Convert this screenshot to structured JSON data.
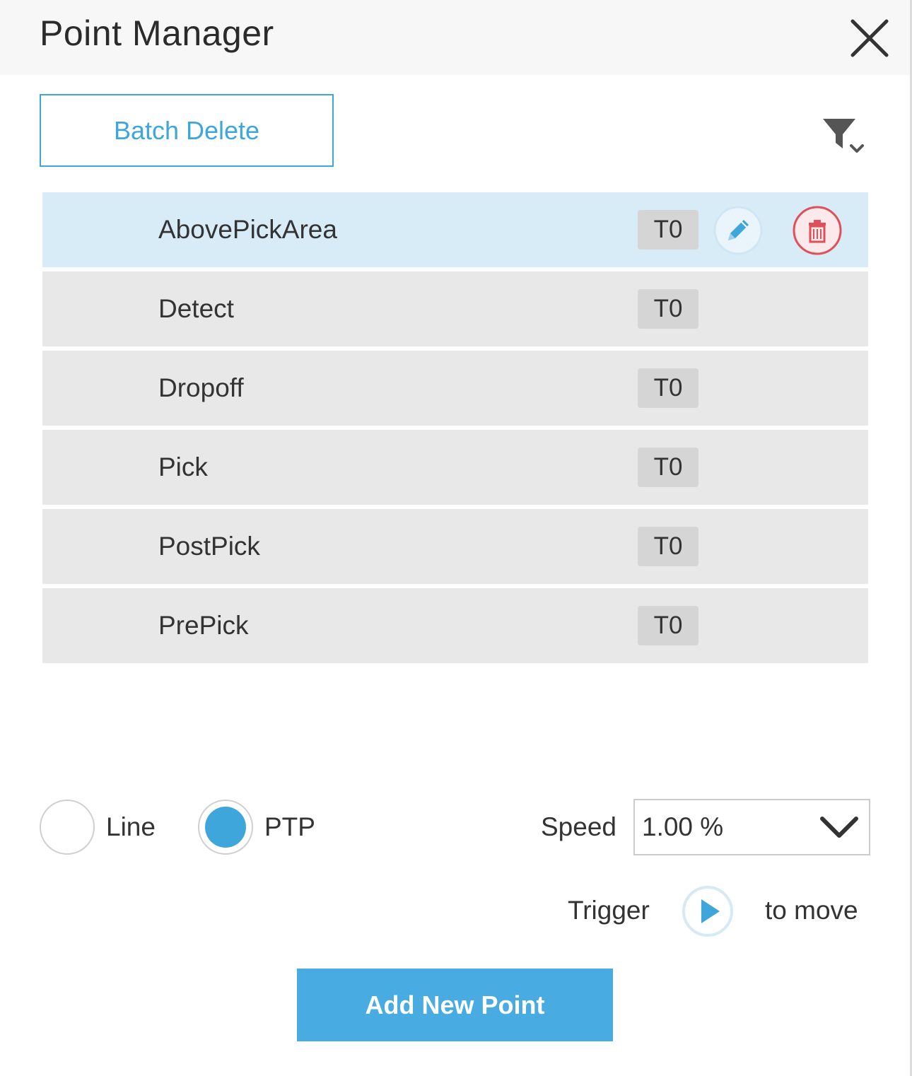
{
  "dialog": {
    "title": "Point Manager",
    "close_icon": "close-icon"
  },
  "toolbar": {
    "batch_delete_label": "Batch Delete",
    "filter_icon": "filter-dropdown-icon"
  },
  "points": [
    {
      "name": "AbovePickArea",
      "tool": "T0",
      "selected": true
    },
    {
      "name": "Detect",
      "tool": "T0",
      "selected": false
    },
    {
      "name": "Dropoff",
      "tool": "T0",
      "selected": false
    },
    {
      "name": "Pick",
      "tool": "T0",
      "selected": false
    },
    {
      "name": "PostPick",
      "tool": "T0",
      "selected": false
    },
    {
      "name": "PrePick",
      "tool": "T0",
      "selected": false
    }
  ],
  "motion": {
    "line_label": "Line",
    "ptp_label": "PTP",
    "selected": "PTP"
  },
  "speed": {
    "label": "Speed",
    "value": "1.00 %"
  },
  "trigger": {
    "prefix": "Trigger",
    "suffix": "to move"
  },
  "footer": {
    "add_label": "Add New Point"
  },
  "colors": {
    "accent": "#3fa6dc",
    "selected_row": "#d8ecf8",
    "row": "#e8e8e8",
    "delete": "#e0505a"
  }
}
